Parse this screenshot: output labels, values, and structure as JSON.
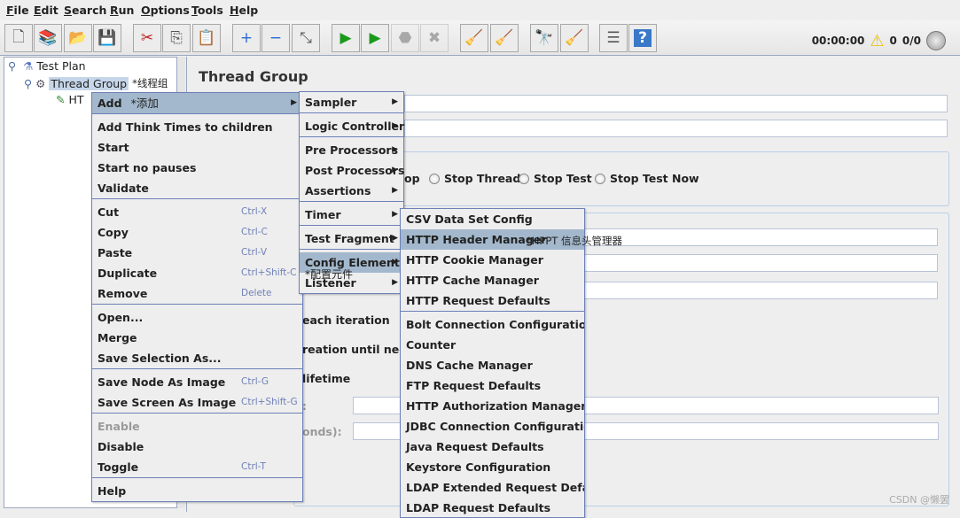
{
  "menubar": [
    "File",
    "Edit",
    "Search",
    "Run",
    "Options",
    "Tools",
    "Help"
  ],
  "toolbar": [
    {
      "icon": "new-icon",
      "g": "🗋"
    },
    {
      "icon": "templates-icon",
      "g": "📚"
    },
    {
      "icon": "open-icon",
      "g": "📂"
    },
    {
      "icon": "save-icon",
      "g": "💾"
    },
    {
      "icon": "cut-icon",
      "g": "✂"
    },
    {
      "icon": "copy-icon",
      "g": "⎘"
    },
    {
      "icon": "paste-icon",
      "g": "📋"
    },
    {
      "icon": "expand-icon",
      "g": "+"
    },
    {
      "icon": "collapse-icon",
      "g": "−"
    },
    {
      "icon": "toggle-icon",
      "g": "⤡"
    },
    {
      "icon": "start-icon",
      "g": "▶"
    },
    {
      "icon": "start-no-timers-icon",
      "g": "▶"
    },
    {
      "icon": "stop-icon",
      "g": "⬣",
      "disabled": true
    },
    {
      "icon": "shutdown-icon",
      "g": "✖",
      "disabled": true
    },
    {
      "icon": "clear-icon",
      "g": "🧹"
    },
    {
      "icon": "clear-all-icon",
      "g": "🧹"
    },
    {
      "icon": "search-icon",
      "g": "🔭"
    },
    {
      "icon": "reset-search-icon",
      "g": "🧹"
    },
    {
      "icon": "function-helper-icon",
      "g": "☰"
    },
    {
      "icon": "help-icon",
      "g": "?"
    }
  ],
  "status": {
    "timer": "00:00:00",
    "warnings": "0",
    "threads": "0/0"
  },
  "tree": {
    "test_plan": "Test Plan",
    "thread_group": "Thread Group",
    "thread_group_note": "*线程组",
    "child": "HT"
  },
  "main": {
    "title": "Thread Group",
    "radios": [
      "op",
      "Stop Thread",
      "Stop Test",
      "Stop Test Now"
    ],
    "labels": [
      "each iteration",
      "reation until needed",
      "lifetime",
      ":",
      "onds):"
    ]
  },
  "context_menu": [
    {
      "label": "Add",
      "note": "*添加",
      "arrow": true,
      "hl": true
    },
    {
      "sep": true
    },
    {
      "label": "Add Think Times to children"
    },
    {
      "label": "Start"
    },
    {
      "label": "Start no pauses"
    },
    {
      "label": "Validate"
    },
    {
      "sep": true
    },
    {
      "label": "Cut",
      "sc": "Ctrl-X"
    },
    {
      "label": "Copy",
      "sc": "Ctrl-C"
    },
    {
      "label": "Paste",
      "sc": "Ctrl-V"
    },
    {
      "label": "Duplicate",
      "sc": "Ctrl+Shift-C"
    },
    {
      "label": "Remove",
      "sc": "Delete"
    },
    {
      "sep": true
    },
    {
      "label": "Open..."
    },
    {
      "label": "Merge"
    },
    {
      "label": "Save Selection As..."
    },
    {
      "sep": true
    },
    {
      "label": "Save Node As Image",
      "sc": "Ctrl-G"
    },
    {
      "label": "Save Screen As Image",
      "sc": "Ctrl+Shift-G"
    },
    {
      "sep": true
    },
    {
      "label": "Enable",
      "disabled": true
    },
    {
      "label": "Disable"
    },
    {
      "label": "Toggle",
      "sc": "Ctrl-T"
    },
    {
      "sep": true
    },
    {
      "label": "Help"
    }
  ],
  "add_menu": [
    {
      "label": "Sampler",
      "arrow": true
    },
    {
      "sep": true
    },
    {
      "label": "Logic Controller",
      "arrow": true
    },
    {
      "sep": true
    },
    {
      "label": "Pre Processors",
      "arrow": true
    },
    {
      "label": "Post Processors",
      "arrow": true
    },
    {
      "label": "Assertions",
      "arrow": true
    },
    {
      "sep": true
    },
    {
      "label": "Timer",
      "arrow": true
    },
    {
      "sep": true
    },
    {
      "label": "Test Fragment",
      "arrow": true
    },
    {
      "sep": true
    },
    {
      "label": "Config Element",
      "arrow": true,
      "hl": true
    },
    {
      "label": "Listener",
      "arrow": true
    }
  ],
  "config_note": "*配置元件",
  "config_menu": [
    {
      "label": "CSV Data Set Config"
    },
    {
      "label": "HTTP Header Manager",
      "hl": true
    },
    {
      "label": "HTTP Cookie Manager"
    },
    {
      "label": "HTTP Cache Manager"
    },
    {
      "label": "HTTP Request Defaults"
    },
    {
      "sep": true
    },
    {
      "label": "Bolt Connection Configuration"
    },
    {
      "label": "Counter"
    },
    {
      "label": "DNS Cache Manager"
    },
    {
      "label": "FTP Request Defaults"
    },
    {
      "label": "HTTP Authorization Manager"
    },
    {
      "label": "JDBC Connection Configuration"
    },
    {
      "label": "Java Request Defaults"
    },
    {
      "label": "Keystore Configuration"
    },
    {
      "label": "LDAP Extended Request Defaults"
    },
    {
      "label": "LDAP Request Defaults"
    }
  ],
  "header_note": "*HPPT 信息头管理器",
  "watermark": "CSDN @懒罢",
  "colors": {
    "highlight": "#a3b8cc",
    "menu_border": "#6d80b8",
    "shortcut": "#7080b8"
  }
}
